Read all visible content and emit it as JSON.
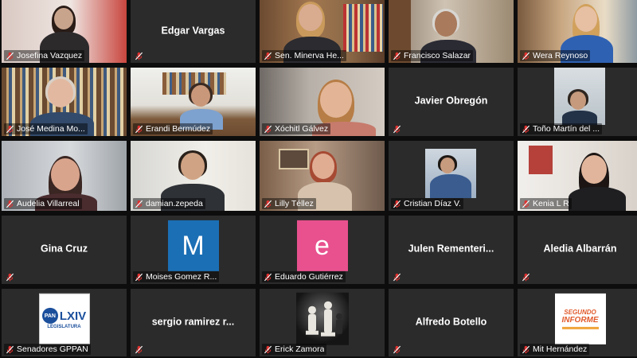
{
  "tiles": [
    {
      "kind": "video",
      "name": "Josefina Vazquez",
      "scene": "pink-room"
    },
    {
      "kind": "name",
      "name": "Edgar Vargas"
    },
    {
      "kind": "video",
      "name": "Sen. Minerva Hernández",
      "display": "Sen. Minerva He...",
      "scene": "bookshelf-woman"
    },
    {
      "kind": "video",
      "name": "Francisco Salazar",
      "scene": "office-man"
    },
    {
      "kind": "video",
      "name": "Wera Reynoso",
      "scene": "shelf-woman-blonde",
      "active": true
    },
    {
      "kind": "video",
      "name": "José Medina Mora",
      "display": "José Medina Mo...",
      "scene": "library-man"
    },
    {
      "kind": "video",
      "name": "Erandi Bermúdez",
      "scene": "desk-man"
    },
    {
      "kind": "video",
      "name": "Xóchitl Gálvez",
      "scene": "glasses-woman"
    },
    {
      "kind": "name",
      "name": "Javier Obregón"
    },
    {
      "kind": "video",
      "name": "Toño Martín del Campo",
      "display": "Toño Martín del ...",
      "scene": "small-man"
    },
    {
      "kind": "video",
      "name": "Audelia Villarreal",
      "scene": "glasses-woman-2"
    },
    {
      "kind": "video",
      "name": "damian.zepeda",
      "scene": "man-white"
    },
    {
      "kind": "video",
      "name": "Lilly Téllez",
      "scene": "living-woman"
    },
    {
      "kind": "video",
      "name": "Cristian Díaz V.",
      "scene": "phone-man"
    },
    {
      "kind": "video",
      "name": "Kenia L R",
      "scene": "dark-hair-woman"
    },
    {
      "kind": "name",
      "name": "Gina Cruz"
    },
    {
      "kind": "avatar",
      "name": "Moises Gomez Reyna",
      "display": "Moises Gomez R...",
      "letter": "M",
      "color": "#1b6fb5"
    },
    {
      "kind": "avatar",
      "name": "Eduardo Gutiérrez",
      "letter": "e",
      "color": "#e8518e"
    },
    {
      "kind": "name",
      "name": "Julen  Rementería",
      "center_display": "Julen  Rementeri..."
    },
    {
      "kind": "name",
      "name": "Aledia Albarrán"
    },
    {
      "kind": "logo",
      "name": "Senadores GPPAN",
      "logo": "pan"
    },
    {
      "kind": "name",
      "name": "sergio ramirez r...",
      "center_display": "sergio ramirez r..."
    },
    {
      "kind": "logo",
      "name": "Erick Zamora",
      "logo": "chess"
    },
    {
      "kind": "name",
      "name": "Alfredo Botello"
    },
    {
      "kind": "logo",
      "name": "Mit Hernández",
      "logo": "informe"
    }
  ],
  "logo_text": {
    "pan_main": "LXIV",
    "pan_sub": "LEGISLATURA",
    "pan_badge": "PAN",
    "informe_line1": "SEGUNDO",
    "informe_line2": "INFORME"
  },
  "colors": {
    "tile_bg": "#2b2b2b",
    "active_border": "#d9d96a",
    "mic_muted": "#e0312f"
  }
}
